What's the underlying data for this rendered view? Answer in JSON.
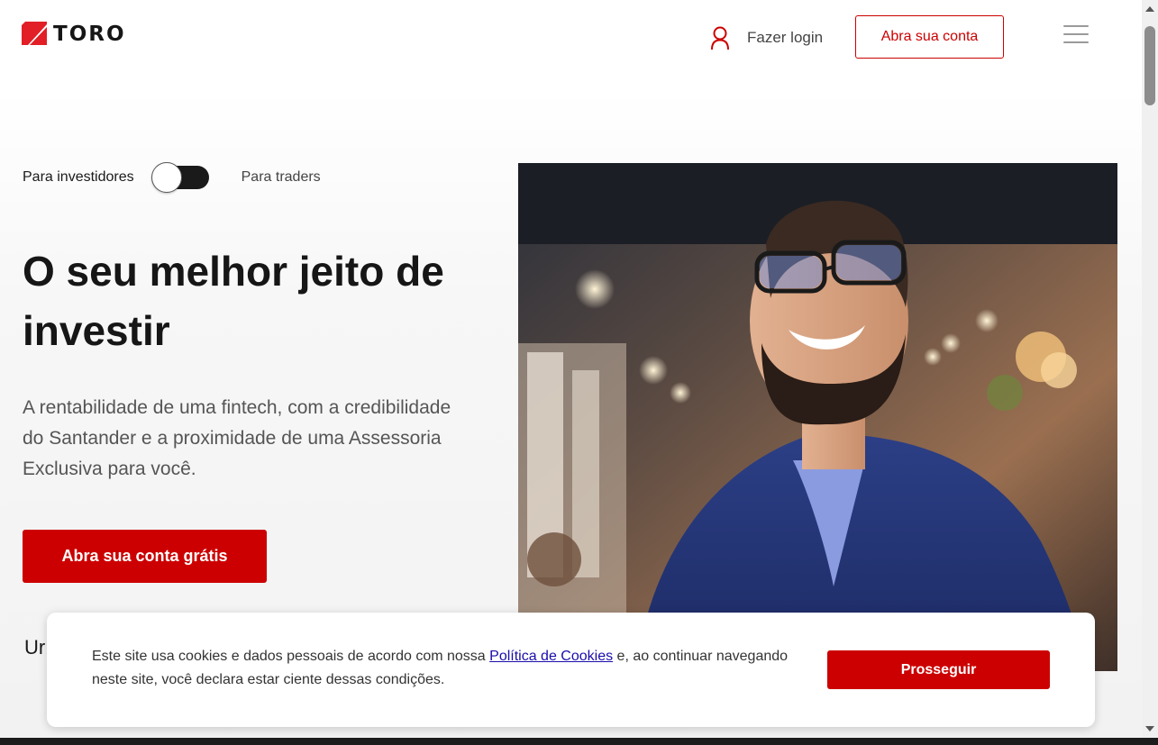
{
  "header": {
    "brand": "TORO",
    "login_label": "Fazer login",
    "open_account_label": "Abra sua conta"
  },
  "toggle": {
    "investors_label": "Para investidores",
    "traders_label": "Para traders",
    "selected": "Para investidores"
  },
  "hero": {
    "title": "O seu melhor jeito de investir",
    "subtitle": "A rentabilidade de uma fintech, com a credibilidade do Santander e a proximidade de uma Assessoria Exclusiva para você.",
    "cta_label": "Abra sua conta grátis",
    "partial_text": "Ur"
  },
  "cookie_banner": {
    "text_before": "Este site usa cookies e dados pessoais de acordo com nossa ",
    "link_label": "Política de Cookies",
    "text_after": " e, ao continuar navegando neste site, você declara estar ciente dessas condições.",
    "button_label": "Prosseguir"
  },
  "colors": {
    "brand_red": "#cc0000",
    "text_dark": "#161616",
    "link_blue": "#1a0dab"
  },
  "icons": [
    "toro-logo-icon",
    "user-icon",
    "hamburger-menu-icon"
  ]
}
